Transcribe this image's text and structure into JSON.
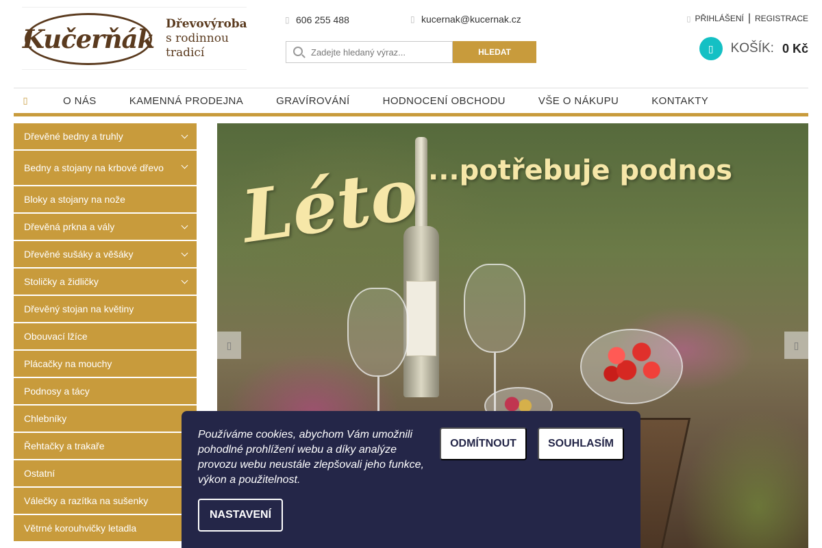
{
  "logo": {
    "word": "Kučerňák",
    "tagline_1": "Dřevovýroba",
    "tagline_2": "s rodinnou",
    "tagline_3": "tradicí"
  },
  "contact": {
    "phone": "606 255 488",
    "email": "kucernak@kucernak.cz"
  },
  "search": {
    "placeholder": "Zadejte hledaný výraz...",
    "button": "HLEDAT"
  },
  "account": {
    "login": "PŘIHLÁŠENÍ",
    "separator": "|",
    "register": "REGISTRACE"
  },
  "cart": {
    "label": "KOŠÍK:",
    "total": "0 Kč"
  },
  "nav": {
    "items": [
      "O NÁS",
      "KAMENNÁ PRODEJNA",
      "GRAVÍROVÁNÍ",
      "HODNOCENÍ OBCHODU",
      "VŠE O NÁKUPU",
      "KONTAKTY"
    ]
  },
  "sidebar": {
    "items": [
      {
        "label": "Dřevěné bedny a truhly",
        "has_submenu": true
      },
      {
        "label": "Bedny a stojany na krbové dřevo",
        "has_submenu": true
      },
      {
        "label": "Bloky a stojany na nože",
        "has_submenu": false
      },
      {
        "label": "Dřevěná prkna a vály",
        "has_submenu": true
      },
      {
        "label": "Dřevěné sušáky a věšáky",
        "has_submenu": true
      },
      {
        "label": "Stoličky a židličky",
        "has_submenu": true
      },
      {
        "label": "Dřevěný stojan na květiny",
        "has_submenu": false
      },
      {
        "label": "Obouvací lžíce",
        "has_submenu": false
      },
      {
        "label": "Plácačky na mouchy",
        "has_submenu": false
      },
      {
        "label": "Podnosy a tácy",
        "has_submenu": false
      },
      {
        "label": "Chlebníky",
        "has_submenu": false
      },
      {
        "label": "Řehtačky a trakaře",
        "has_submenu": false
      },
      {
        "label": "Ostatní",
        "has_submenu": false
      },
      {
        "label": "Válečky a razítka na sušenky",
        "has_submenu": false
      },
      {
        "label": "Větrné korouhvičky letadla",
        "has_submenu": false
      }
    ]
  },
  "banner": {
    "title_1": "Léto",
    "title_2": "...potřebuje podnos"
  },
  "cookie": {
    "text": "Používáme cookies, abychom Vám umožnili pohodlné prohlížení webu a díky analýze provozu webu neustále zlepšovali jeho funkce, výkon a použitelnost.",
    "reject": "ODMÍTNOUT",
    "accept": "SOUHLASÍM",
    "settings": "NASTAVENÍ"
  },
  "colors": {
    "accent": "#c89b3c",
    "cart_icon": "#14c0c4",
    "cookie_bg": "#242648",
    "logo_brown": "#5a3a1e"
  }
}
